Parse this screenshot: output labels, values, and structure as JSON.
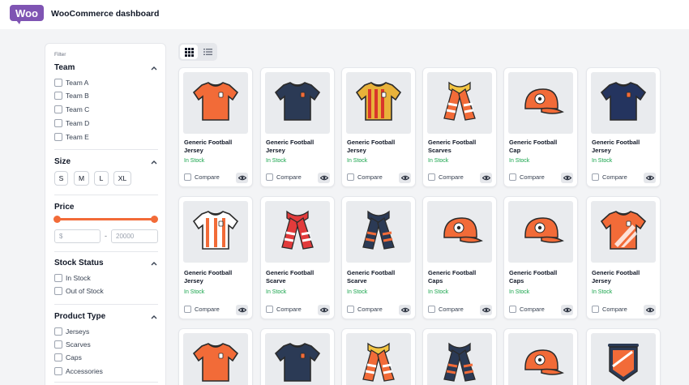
{
  "app": {
    "logo_text": "Woo",
    "title": "WooCommerce dashboard"
  },
  "filter": {
    "heading": "Filter",
    "team": {
      "title": "Team",
      "options": [
        "Team A",
        "Team B",
        "Team C",
        "Team D",
        "Team E"
      ]
    },
    "size": {
      "title": "Size",
      "options": [
        "S",
        "M",
        "L",
        "XL"
      ]
    },
    "price": {
      "title": "Price",
      "min_placeholder": "$",
      "max_placeholder": "20000",
      "separator": "-"
    },
    "stock_status": {
      "title": "Stock Status",
      "options": [
        "In Stock",
        "Out of Stock"
      ]
    },
    "product_type": {
      "title": "Product Type",
      "options": [
        "Jerseys",
        "Scarves",
        "Caps",
        "Accessories"
      ]
    }
  },
  "view_toggle": {
    "active": "grid",
    "icons": [
      "grid-view-icon",
      "list-view-icon"
    ]
  },
  "products": [
    {
      "name_line1": "Generic Football",
      "name_line2": "Jersey",
      "stock": "In Stock",
      "compare_label": "Compare",
      "icon": "jersey-icon",
      "color": "#f26b38"
    },
    {
      "name_line1": "Generic Football",
      "name_line2": "Jersey",
      "stock": "In Stock",
      "compare_label": "Compare",
      "icon": "jersey-icon",
      "color": "#2b3a55"
    },
    {
      "name_line1": "Generic Football",
      "name_line2": "Jersey",
      "stock": "In Stock",
      "compare_label": "Compare",
      "icon": "jersey-icon",
      "color": "#e8b23a"
    },
    {
      "name_line1": "Generic Football",
      "name_line2": "Scarves",
      "stock": "In Stock",
      "compare_label": "Compare",
      "icon": "scarf-icon",
      "color": "#f26b38"
    },
    {
      "name_line1": "Generic Football",
      "name_line2": "Cap",
      "stock": "In Stock",
      "compare_label": "Compare",
      "icon": "cap-icon",
      "color": "#f26b38"
    },
    {
      "name_line1": "Generic Football",
      "name_line2": "Jersey",
      "stock": "In Stock",
      "compare_label": "Compare",
      "icon": "jersey-icon",
      "color": "#24345f"
    },
    {
      "name_line1": "Generic Football",
      "name_line2": "Jersey",
      "stock": "In Stock",
      "compare_label": "Compare",
      "icon": "jersey-icon",
      "color": "#ffffff"
    },
    {
      "name_line1": "Generic Football",
      "name_line2": "Scarve",
      "stock": "In Stock",
      "compare_label": "Compare",
      "icon": "scarf-icon",
      "color": "#e23b3b"
    },
    {
      "name_line1": "Generic Football",
      "name_line2": "Scarve",
      "stock": "In Stock",
      "compare_label": "Compare",
      "icon": "scarf-icon",
      "color": "#2b3a55"
    },
    {
      "name_line1": "Generic Football",
      "name_line2": "Caps",
      "stock": "In Stock",
      "compare_label": "Compare",
      "icon": "cap-icon",
      "color": "#f26b38"
    },
    {
      "name_line1": "Generic Football",
      "name_line2": "Caps",
      "stock": "In Stock",
      "compare_label": "Compare",
      "icon": "cap-icon",
      "color": "#f26b38"
    },
    {
      "name_line1": "Generic Football",
      "name_line2": "Jersey",
      "stock": "In Stock",
      "compare_label": "Compare",
      "icon": "polo-jersey-icon",
      "color": "#f26b38"
    },
    {
      "name_line1": "",
      "name_line2": "",
      "stock": "",
      "compare_label": "",
      "icon": "jersey-icon",
      "color": "#f26b38"
    },
    {
      "name_line1": "",
      "name_line2": "",
      "stock": "",
      "compare_label": "",
      "icon": "jersey-icon",
      "color": "#2b3a55"
    },
    {
      "name_line1": "",
      "name_line2": "",
      "stock": "",
      "compare_label": "",
      "icon": "scarf-icon",
      "color": "#f26b38"
    },
    {
      "name_line1": "",
      "name_line2": "",
      "stock": "",
      "compare_label": "",
      "icon": "scarf-icon",
      "color": "#2b3a55"
    },
    {
      "name_line1": "",
      "name_line2": "",
      "stock": "",
      "compare_label": "",
      "icon": "cap-icon",
      "color": "#f26b38"
    },
    {
      "name_line1": "",
      "name_line2": "",
      "stock": "",
      "compare_label": "",
      "icon": "pennant-icon",
      "color": "#f26b38"
    }
  ],
  "colors": {
    "accent": "#f26b38",
    "brand": "#7f54b3",
    "stock": "#16a34a",
    "navy": "#2b3a55"
  }
}
